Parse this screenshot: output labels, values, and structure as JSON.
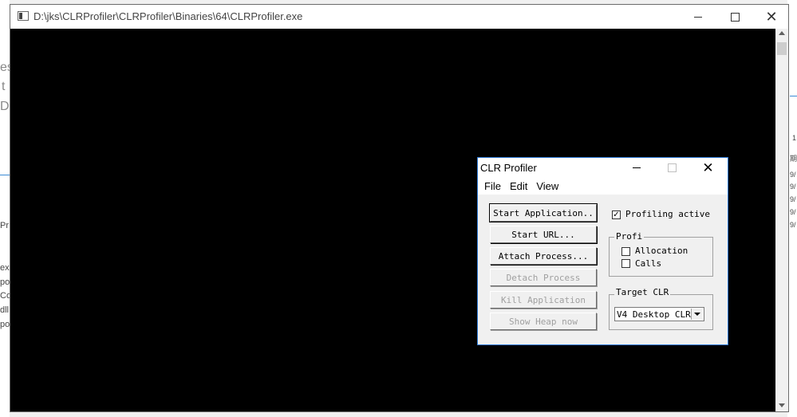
{
  "console_window": {
    "title": "D:\\jks\\CLRProfiler\\CLRProfiler\\Binaries\\64\\CLRProfiler.exe",
    "minimize": "—",
    "maximize": "☐",
    "close": "✕"
  },
  "dialog": {
    "title": "CLR Profiler",
    "close": "✕",
    "menu": [
      "File",
      "Edit",
      "View"
    ],
    "buttons": [
      {
        "label": "Start Application..",
        "enabled": true
      },
      {
        "label": "Start URL...",
        "enabled": true
      },
      {
        "label": "Attach Process...",
        "enabled": true
      },
      {
        "label": "Detach Process",
        "enabled": false
      },
      {
        "label": "Kill Application",
        "enabled": false
      },
      {
        "label": "Show Heap now",
        "enabled": false
      }
    ],
    "profiling_active": {
      "label": "Profiling active",
      "checked": true
    },
    "profile_group": {
      "title": "Profi",
      "allocation": {
        "label": "Allocation",
        "checked": false
      },
      "calls": {
        "label": "Calls",
        "checked": false
      }
    },
    "target_group": {
      "title": "Target CLR",
      "selected": "V4 Desktop CLR"
    }
  },
  "background_fragments": {
    "left": [
      "es",
      "t",
      "D",
      "Pr",
      "ex",
      "po",
      "Co",
      "dll",
      "po"
    ],
    "right": [
      "1",
      "期",
      "9/",
      "9/",
      "9/",
      "9/",
      "9/"
    ]
  },
  "icons": [
    "console-app-icon",
    "minimize-icon",
    "maximize-icon",
    "close-icon",
    "checkbox-icon",
    "dropdown-arrow-icon",
    "scroll-up-icon",
    "scroll-down-icon"
  ]
}
